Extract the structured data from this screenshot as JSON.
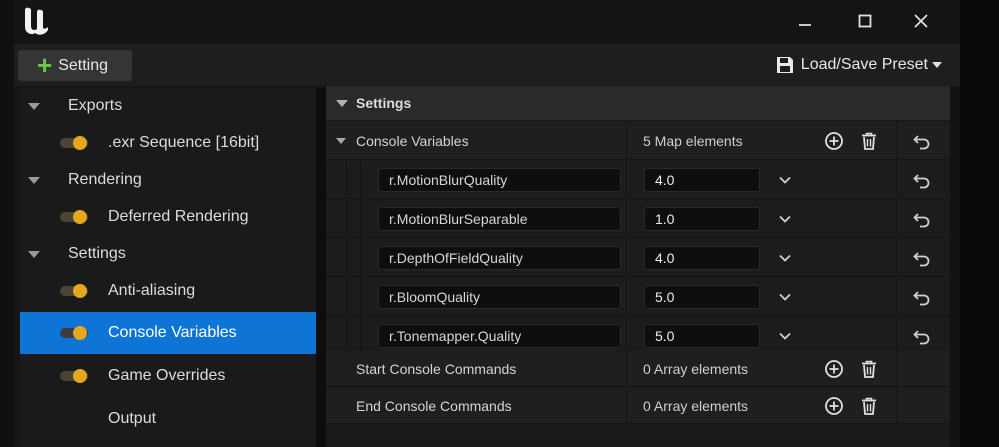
{
  "window": {
    "controls": [
      "minimize",
      "maximize",
      "close"
    ]
  },
  "toolbar": {
    "add_setting_label": "Setting",
    "preset_label": "Load/Save Preset"
  },
  "tree": [
    {
      "kind": "category",
      "label": "Exports"
    },
    {
      "kind": "item",
      "label": ".exr Sequence [16bit]",
      "enabled": true
    },
    {
      "kind": "category",
      "label": "Rendering"
    },
    {
      "kind": "item",
      "label": "Deferred Rendering",
      "enabled": true
    },
    {
      "kind": "category",
      "label": "Settings"
    },
    {
      "kind": "item",
      "label": "Anti-aliasing",
      "enabled": true
    },
    {
      "kind": "item",
      "label": "Console Variables",
      "enabled": true,
      "selected": true
    },
    {
      "kind": "item",
      "label": "Game Overrides",
      "enabled": true
    },
    {
      "kind": "item",
      "label": "Output",
      "enabled": false,
      "no_toggle": true
    }
  ],
  "details": {
    "section_title": "Settings",
    "console_variables": {
      "label": "Console Variables",
      "count": "5 Map elements",
      "entries": [
        {
          "key": "r.MotionBlurQuality",
          "value": "4.0"
        },
        {
          "key": "r.MotionBlurSeparable",
          "value": "1.0"
        },
        {
          "key": "r.DepthOfFieldQuality",
          "value": "4.0"
        },
        {
          "key": "r.BloomQuality",
          "value": "5.0"
        },
        {
          "key": "r.Tonemapper.Quality",
          "value": "5.0"
        }
      ]
    },
    "start_commands": {
      "label": "Start Console Commands",
      "count": "0 Array elements"
    },
    "end_commands": {
      "label": "End Console Commands",
      "count": "0 Array elements"
    }
  },
  "colors": {
    "accent_selected": "#0e74d6",
    "toggle_on": "#e5a81c",
    "add_green": "#6ec64b"
  }
}
